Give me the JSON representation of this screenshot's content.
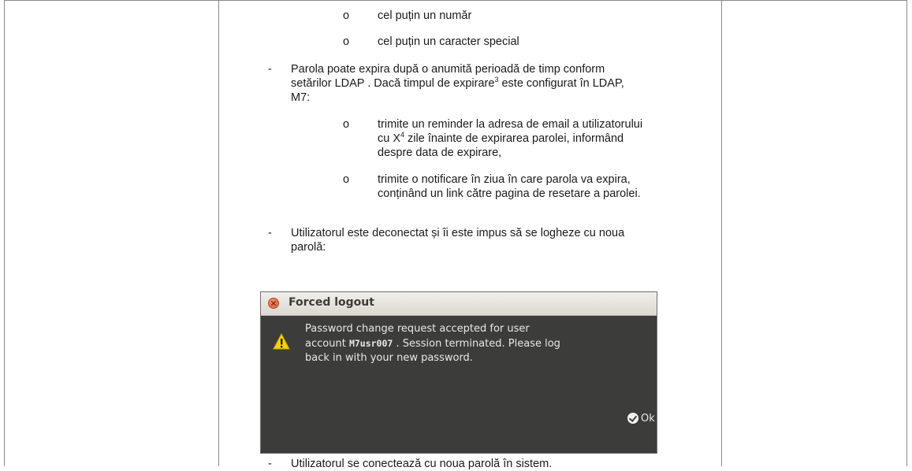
{
  "document": {
    "bullet_sub_1": "o",
    "text_number": "cel puțin un număr",
    "bullet_sub_2": "o",
    "text_special": "cel puțin un caracter special",
    "dash_1": "-",
    "expire_line_1": "Parola poate expira după o anumită perioadă de timp conform",
    "expire_line_2a": "setărilor LDAP . Dacă timpul de expirare",
    "footnote_3": "3",
    "expire_line_2b": " este configurat în LDAP,",
    "expire_line_3": "M7:",
    "bullet_sub_3": "o",
    "reminder_line_1": "trimite un reminder la adresa de email a utilizatorului",
    "reminder_line_2a": "cu X",
    "footnote_4": "4",
    "reminder_line_2b": " zile înainte de expirarea parolei, informând",
    "reminder_line_3": "despre data de expirare,",
    "bullet_sub_4": "o",
    "notify_line_1": "trimite o notificare în ziua în care parola va expira,",
    "notify_line_2": "conținând un link către pagina de resetare a parolei.",
    "dash_2": "-",
    "logout_line_1": "Utilizatorul este deconectat și îi este impus să se logheze cu noua",
    "logout_line_2": "parolă:",
    "dash_3": "-",
    "final_line": "Utilizatorul se conectează cu noua parolă în sistem."
  },
  "dialog": {
    "title": "Forced logout",
    "message_part_1": "Password change request accepted for user",
    "message_part_2a": "account ",
    "account_id": "M7usr007",
    "message_part_2b": " . Session terminated. Please log",
    "message_part_3": "back in with your new password.",
    "ok_label": "Ok"
  },
  "colors": {
    "dialog_bg": "#3c3c3b",
    "titlebar_bg": "#e6e3dd",
    "close_button": "#e0582c",
    "warning_icon": "#f5d100",
    "table_border": "#8a8a8a"
  }
}
